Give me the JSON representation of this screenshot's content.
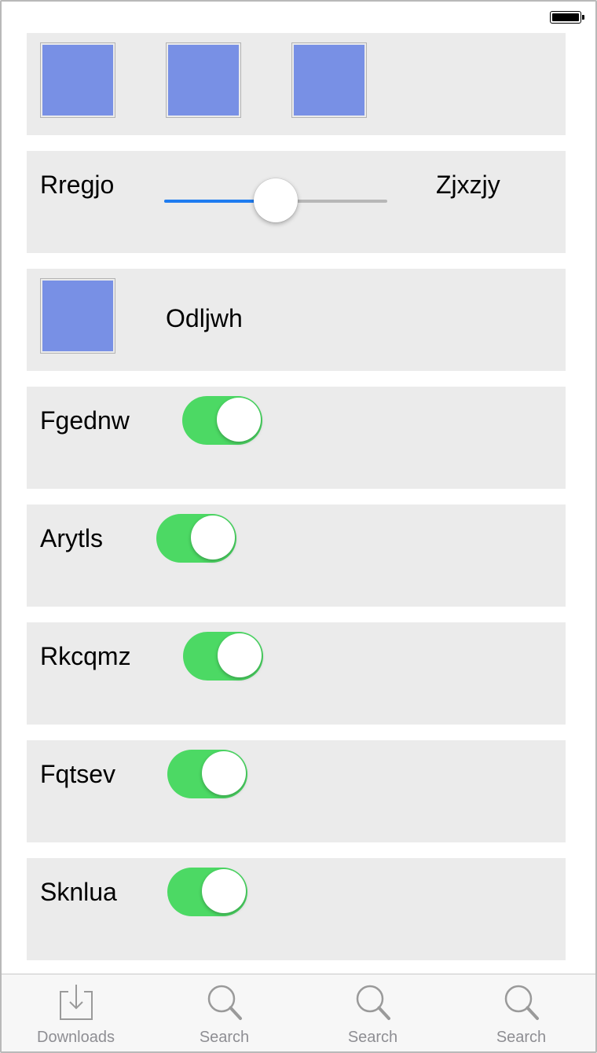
{
  "status_bar": {
    "battery": "full"
  },
  "rows": {
    "image_row": {
      "images": [
        "image",
        "image",
        "image"
      ]
    },
    "slider_row": {
      "left_label": "Rregjo",
      "right_label": "Zjxzjy",
      "value": 0.5,
      "track_color": "#b7b7b7",
      "fill_color": "#1f7cf0"
    },
    "image_label_row": {
      "label": "Odljwh"
    },
    "toggles": [
      {
        "label": "Fgednw",
        "on": true
      },
      {
        "label": "Arytls",
        "on": true
      },
      {
        "label": "Rkcqmz",
        "on": true
      },
      {
        "label": "Fqtsev",
        "on": true
      },
      {
        "label": "Sknlua",
        "on": true
      }
    ]
  },
  "tabbar": {
    "tabs": [
      {
        "label": "Downloads",
        "icon": "downloads-icon"
      },
      {
        "label": "Search",
        "icon": "search-icon"
      },
      {
        "label": "Search",
        "icon": "search-icon"
      },
      {
        "label": "Search",
        "icon": "search-icon"
      }
    ]
  },
  "colors": {
    "accent_green": "#4cd964",
    "thumb_blue": "#7890e5",
    "card_bg": "#ebebeb",
    "tab_gray": "#8e8e93"
  }
}
